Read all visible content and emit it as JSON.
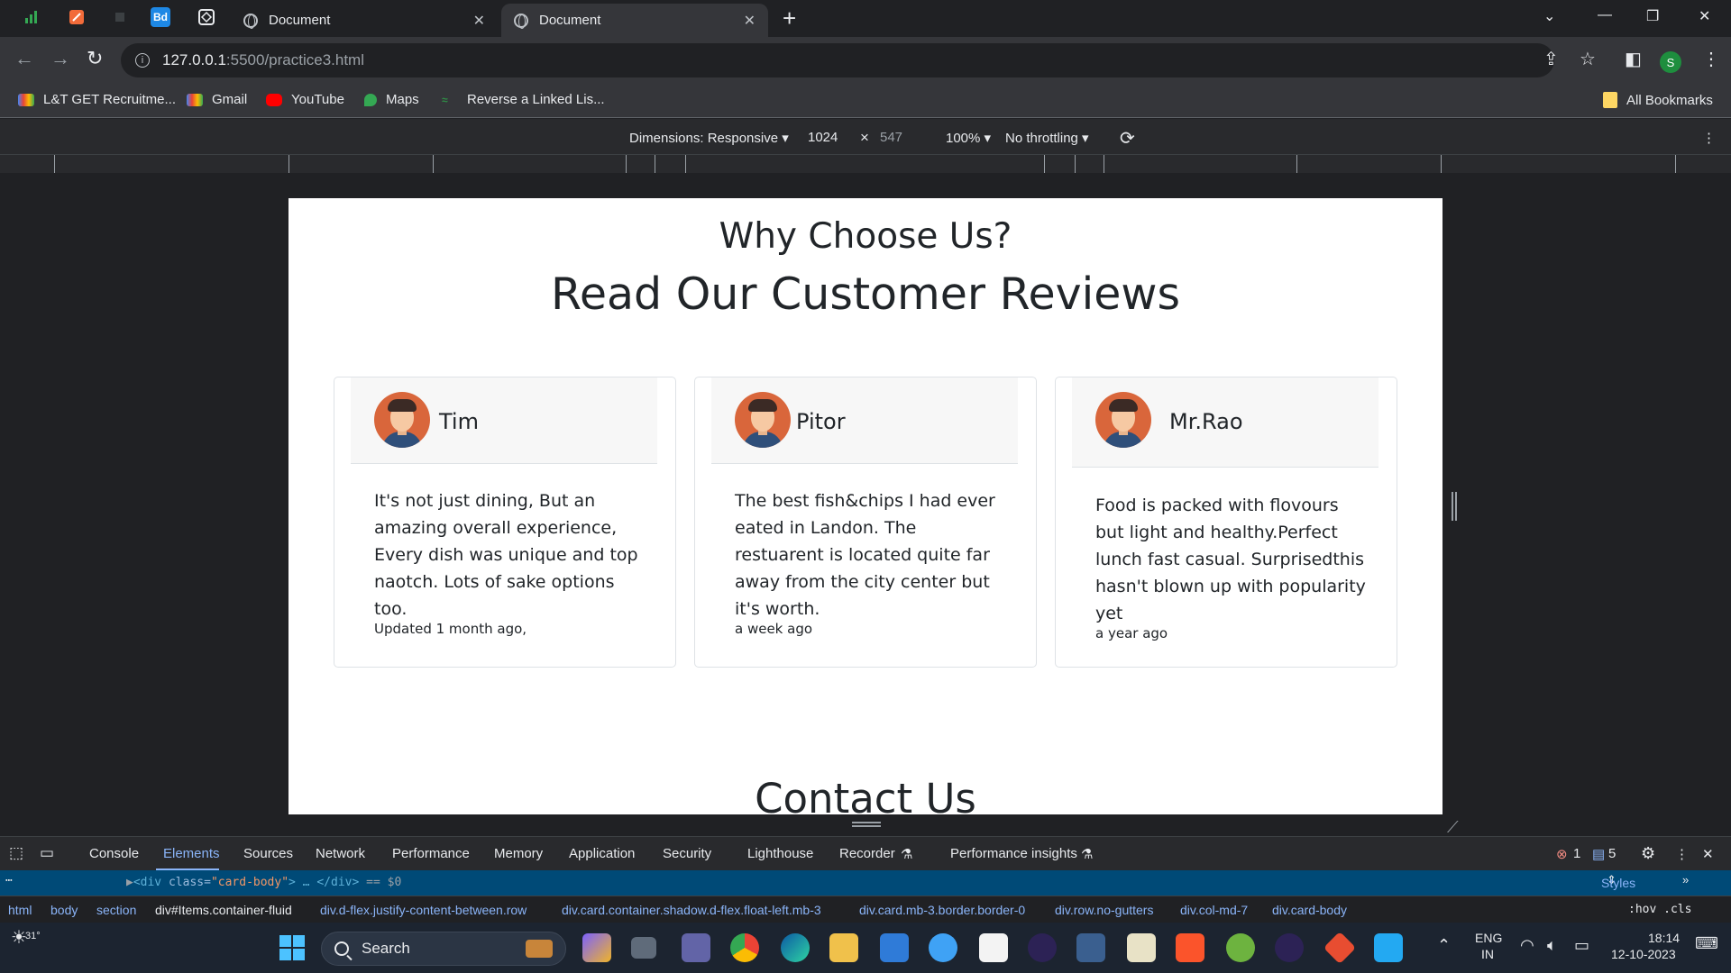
{
  "browser": {
    "tabs": [
      {
        "title": "Document",
        "active": false
      },
      {
        "title": "Document",
        "active": true
      }
    ],
    "pinned_tabs": [
      "sheets-icon",
      "postman-icon",
      "dark-app-icon",
      "bd-icon",
      "codepen-icon"
    ],
    "new_tab": "+",
    "url_host": "127.0.0.1",
    "url_path": ":5500/practice3.html",
    "profile_initial": "S",
    "bookmarks": [
      {
        "label": "L&T GET Recruitme...",
        "icon": "gmail-icon"
      },
      {
        "label": "Gmail",
        "icon": "gmail-icon"
      },
      {
        "label": "YouTube",
        "icon": "youtube-icon"
      },
      {
        "label": "Maps",
        "icon": "maps-icon"
      },
      {
        "label": "Reverse a Linked Lis...",
        "icon": "gfg-icon"
      }
    ],
    "all_bookmarks": "All Bookmarks"
  },
  "device_toolbar": {
    "dimensions": "Dimensions: Responsive",
    "width": "1024",
    "times": "×",
    "height": "547",
    "zoom": "100%",
    "throttling": "No throttling"
  },
  "page": {
    "heading_small": "Why Choose Us?",
    "heading_large": "Read Our Customer Reviews",
    "reviews": [
      {
        "name": "Tim",
        "text": "It's not just dining, But an amazing overall experience, Every dish was unique and top naotch. Lots of sake options too.",
        "meta": "Updated 1 month ago,"
      },
      {
        "name": "Pitor",
        "text": "The best fish&chips I had ever eated in Landon. The restuarent is located quite far away from the city center but it's worth.",
        "meta": "a week ago"
      },
      {
        "name": "Mr.Rao",
        "text": "Food is packed with flovours but light and healthy.Perfect lunch fast casual. Surprisedthis hasn't blown up with popularity yet",
        "meta": "a year ago"
      }
    ],
    "contact_heading": "Contact Us"
  },
  "devtools": {
    "tabs": [
      "Console",
      "Elements",
      "Sources",
      "Network",
      "Performance",
      "Memory",
      "Application",
      "Security",
      "Lighthouse",
      "Recorder",
      "Performance insights"
    ],
    "selected_tab": "Elements",
    "errors": "1",
    "messages": "5",
    "code_open": "<div",
    "code_attr": "class=",
    "code_val": "\"card-body\"",
    "code_close": "> … </div>",
    "code_suffix": "== $0",
    "styles_label": "Styles",
    "breadcrumbs": [
      "html",
      "body",
      "section",
      "div#Items.container-fluid",
      "div.d-flex.justify-content-between.row",
      "div.card.container.shadow.d-flex.float-left.mb-3",
      "div.card.mb-3.border.border-0",
      "div.row.no-gutters",
      "div.col-md-7",
      "div.card-body"
    ],
    "hov_cls": ":hov .cls"
  },
  "taskbar": {
    "weather": "31°",
    "search": "Search",
    "lang_line1": "ENG",
    "lang_line2": "IN",
    "time": "18:14",
    "date": "12-10-2023"
  }
}
